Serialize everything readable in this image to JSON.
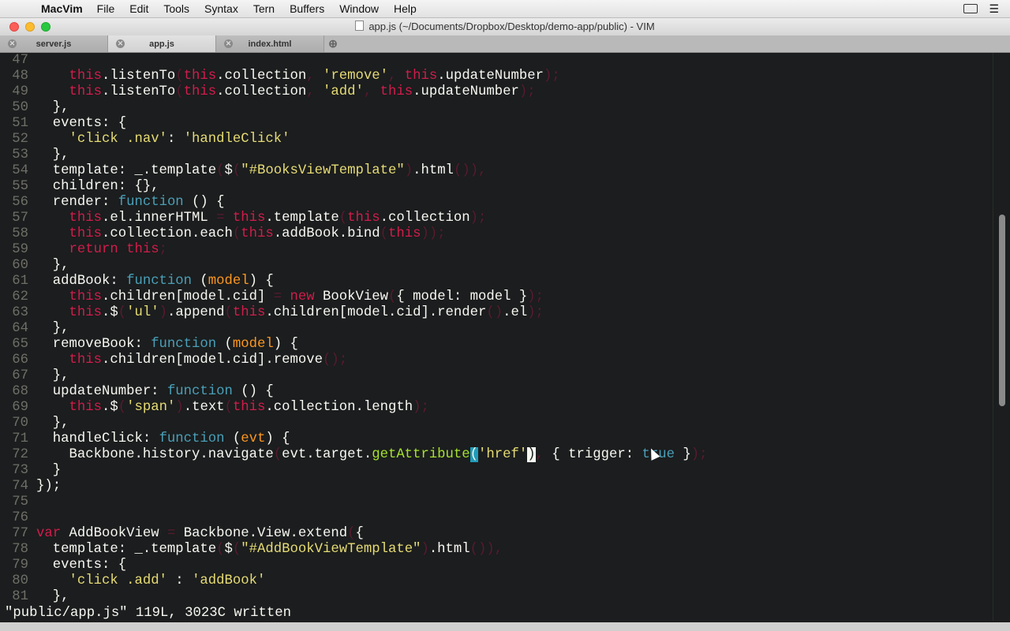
{
  "menubar": {
    "app_name": "MacVim",
    "items": [
      "File",
      "Edit",
      "Tools",
      "Syntax",
      "Tern",
      "Buffers",
      "Window",
      "Help"
    ]
  },
  "window": {
    "title": "app.js (~/Documents/Dropbox/Desktop/demo-app/public) - VIM"
  },
  "tabs": [
    {
      "label": "server.js",
      "active": false
    },
    {
      "label": "app.js",
      "active": true
    },
    {
      "label": "index.html",
      "active": false
    }
  ],
  "editor": {
    "theme_colors": {
      "background": "#1b1d1e",
      "keyword": "#d11d4b",
      "function": "#4a9fb8",
      "string": "#e6db74",
      "param": "#fd971f"
    },
    "lines": [
      {
        "n": "47",
        "text": ""
      },
      {
        "n": "48",
        "text": "    this.listenTo(this.collection, 'remove', this.updateNumber);"
      },
      {
        "n": "49",
        "text": "    this.listenTo(this.collection, 'add', this.updateNumber);"
      },
      {
        "n": "50",
        "text": "  },"
      },
      {
        "n": "51",
        "text": "  events: {"
      },
      {
        "n": "52",
        "text": "    'click .nav': 'handleClick'"
      },
      {
        "n": "53",
        "text": "  },"
      },
      {
        "n": "54",
        "text": "  template: _.template($(\"#BooksViewTemplate\").html()),"
      },
      {
        "n": "55",
        "text": "  children: {},"
      },
      {
        "n": "56",
        "text": "  render: function () {"
      },
      {
        "n": "57",
        "text": "    this.el.innerHTML = this.template(this.collection);"
      },
      {
        "n": "58",
        "text": "    this.collection.each(this.addBook.bind(this));"
      },
      {
        "n": "59",
        "text": "    return this;"
      },
      {
        "n": "60",
        "text": "  },"
      },
      {
        "n": "61",
        "text": "  addBook: function (model) {"
      },
      {
        "n": "62",
        "text": "    this.children[model.cid] = new BookView({ model: model });"
      },
      {
        "n": "63",
        "text": "    this.$('ul').append(this.children[model.cid].render().el);"
      },
      {
        "n": "64",
        "text": "  },"
      },
      {
        "n": "65",
        "text": "  removeBook: function (model) {"
      },
      {
        "n": "66",
        "text": "    this.children[model.cid].remove();"
      },
      {
        "n": "67",
        "text": "  },"
      },
      {
        "n": "68",
        "text": "  updateNumber: function () {"
      },
      {
        "n": "69",
        "text": "    this.$('span').text(this.collection.length);"
      },
      {
        "n": "70",
        "text": "  },"
      },
      {
        "n": "71",
        "text": "  handleClick: function (evt) {"
      },
      {
        "n": "72",
        "text": "    Backbone.history.navigate(evt.target.getAttribute('href'), { trigger: true });"
      },
      {
        "n": "73",
        "text": "  }"
      },
      {
        "n": "74",
        "text": "});"
      },
      {
        "n": "75",
        "text": ""
      },
      {
        "n": "76",
        "text": ""
      },
      {
        "n": "77",
        "text": "var AddBookView = Backbone.View.extend({"
      },
      {
        "n": "78",
        "text": "  template: _.template($(\"#AddBookViewTemplate\").html()),"
      },
      {
        "n": "79",
        "text": "  events: {"
      },
      {
        "n": "80",
        "text": "    'click .add' : 'addBook'"
      },
      {
        "n": "81",
        "text": "  },"
      }
    ]
  },
  "status": {
    "message": "\"public/app.js\" 119L, 3023C written"
  }
}
